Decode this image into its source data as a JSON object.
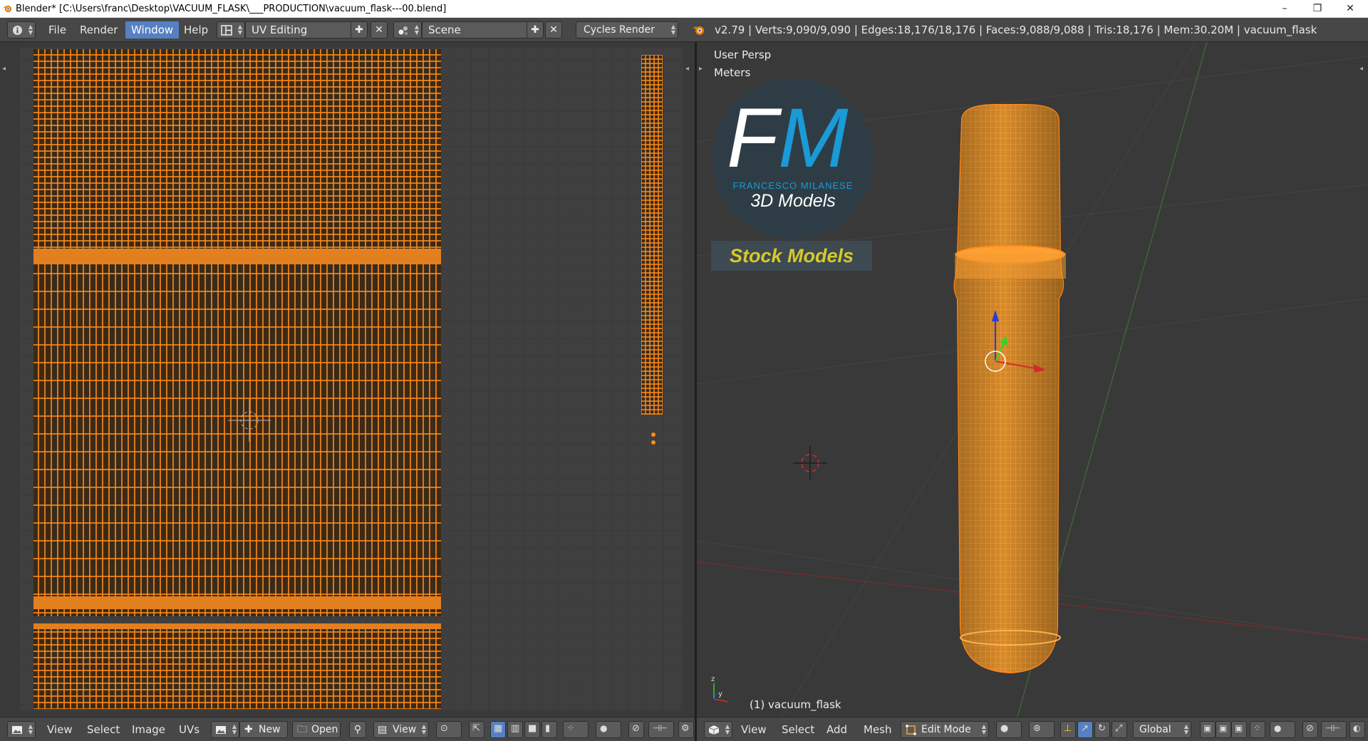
{
  "window": {
    "title": "Blender* [C:\\Users\\franc\\Desktop\\VACUUM_FLASK\\___PRODUCTION\\vacuum_flask---00.blend]",
    "minimize": "–",
    "maximize": "❐",
    "close": "✕"
  },
  "topbar": {
    "info_icon": "info-icon",
    "menus": [
      "File",
      "Render",
      "Window",
      "Help"
    ],
    "active_menu": "Window",
    "screen_layout": "UV Editing",
    "scene": "Scene",
    "render_engine": "Cycles Render",
    "stats": "v2.79 | Verts:9,090/9,090 | Edges:18,176/18,176 | Faces:9,088/9,088 | Tris:18,176 | Mem:30.20M | vacuum_flask"
  },
  "uv_editor": {
    "menus": [
      "View",
      "Select",
      "Image",
      "UVs"
    ],
    "new_label": "New",
    "open_label": "Open",
    "view_label": "View"
  },
  "viewport": {
    "view_name": "User Persp",
    "units": "Meters",
    "object_label": "(1) vacuum_flask",
    "menus": [
      "View",
      "Select",
      "Add",
      "Mesh"
    ],
    "mode": "Edit Mode",
    "orientation": "Global"
  },
  "overlay_logo": {
    "letters_f": "F",
    "letters_m": "M",
    "author": "FRANCESCO MILANESE",
    "tagline": "3D Models",
    "banner": "Stock Models"
  },
  "colors": {
    "accent": "#5680c2",
    "selection": "#ff8c00",
    "panel": "#474747",
    "background": "#393939"
  }
}
